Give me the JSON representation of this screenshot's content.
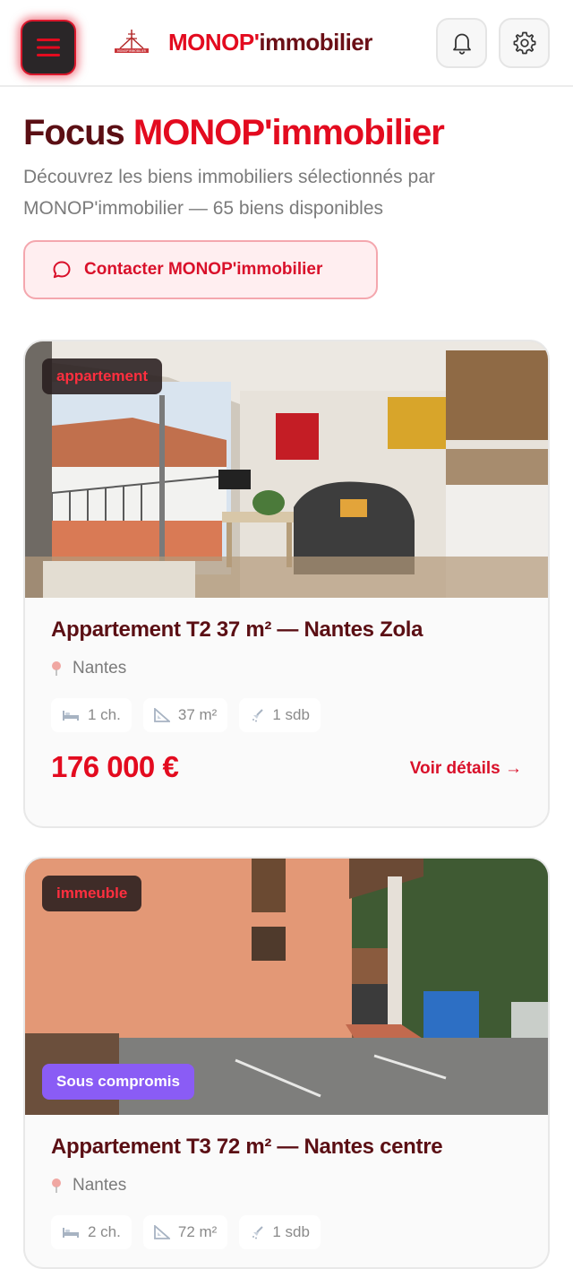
{
  "header": {
    "brand_red": "MONOP'",
    "brand_dark": "immobilier",
    "logo_text": "MONOP'IMMOBILIER"
  },
  "hero": {
    "title_dark": "Focus",
    "title_red": "MONOP'immobilier",
    "subtitle": "Découvrez les biens immobiliers sélectionnés par MONOP'immobilier — 65 biens disponibles",
    "contact_label": "Contacter MONOP'immobilier"
  },
  "listings": [
    {
      "type": "appartement",
      "status": "",
      "title": "Appartement T2 37 m² — Nantes Zola",
      "city": "Nantes",
      "bedrooms": "1 ch.",
      "area": "37 m²",
      "bathrooms": "1 sdb",
      "price": "176 000 €",
      "details_label": "Voir détails →"
    },
    {
      "type": "immeuble",
      "status": "Sous compromis",
      "title": "Appartement T3 72 m² — Nantes centre",
      "city": "Nantes",
      "bedrooms": "2 ch.",
      "area": "72 m²",
      "bathrooms": "1 sdb",
      "price": "",
      "details_label": ""
    }
  ],
  "colors": {
    "brand_red": "#e30b1f",
    "brand_dark": "#5b0f14",
    "status_purple": "#8a5cf5"
  },
  "icons": [
    "menu-icon",
    "logo-icon",
    "bell-icon",
    "gear-icon",
    "chat-bubble-icon",
    "location-pin-icon",
    "bed-icon",
    "ruler-icon",
    "shower-icon"
  ]
}
